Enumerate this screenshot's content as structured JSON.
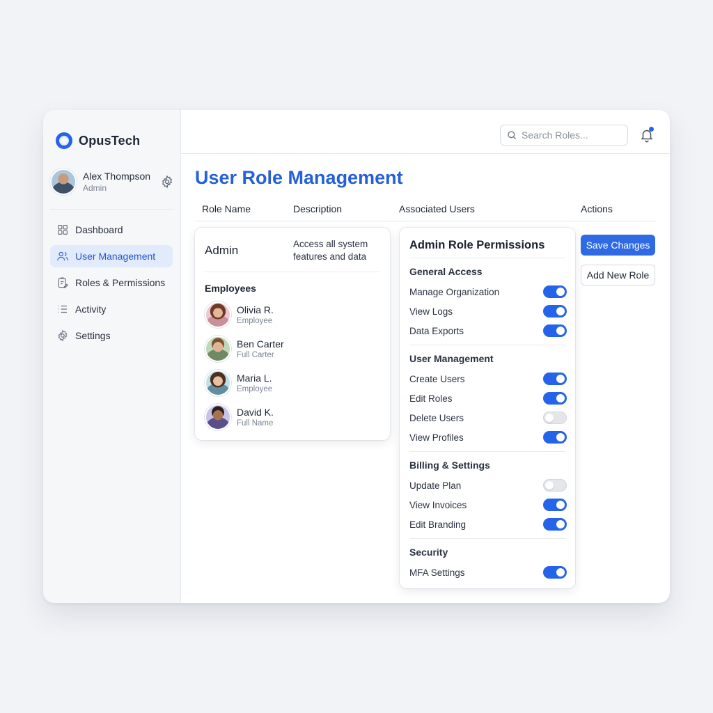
{
  "brand": {
    "name": "OpusTech",
    "accent": "#2563eb"
  },
  "user": {
    "name": "Alex Thompson",
    "role": "Admin"
  },
  "sidebar": {
    "items": [
      {
        "label": "Dashboard",
        "icon": "grid-icon"
      },
      {
        "label": "User Management",
        "icon": "users-icon",
        "active": true
      },
      {
        "label": "Roles & Permissions",
        "icon": "clipboard-icon"
      },
      {
        "label": "Activity",
        "icon": "list-icon"
      },
      {
        "label": "Settings",
        "icon": "gear-icon"
      }
    ]
  },
  "topbar": {
    "search_placeholder": "Search Roles..."
  },
  "page": {
    "title": "User Role Management"
  },
  "table": {
    "columns": [
      "Role Name",
      "Description",
      "Associated Users",
      "Actions"
    ]
  },
  "role": {
    "name": "Admin",
    "description": "Access all system features and data",
    "employees_title": "Employees",
    "employees": [
      {
        "name": "Olivia R.",
        "subtitle": "Employee"
      },
      {
        "name": "Ben Carter",
        "subtitle": "Full Carter"
      },
      {
        "name": "Maria L.",
        "subtitle": "Employee"
      },
      {
        "name": "David K.",
        "subtitle": "Full Name"
      }
    ]
  },
  "permissions": {
    "title": "Admin Role Permissions",
    "groups": [
      {
        "title": "General Access",
        "items": [
          {
            "label": "Manage Organization",
            "enabled": true
          },
          {
            "label": "View Logs",
            "enabled": true
          },
          {
            "label": "Data Exports",
            "enabled": true
          }
        ]
      },
      {
        "title": "User Management",
        "items": [
          {
            "label": "Create Users",
            "enabled": true
          },
          {
            "label": "Edit Roles",
            "enabled": true
          },
          {
            "label": "Delete Users",
            "enabled": false
          },
          {
            "label": "View Profiles",
            "enabled": true
          }
        ]
      },
      {
        "title": "Billing & Settings",
        "items": [
          {
            "label": "Update Plan",
            "enabled": false
          },
          {
            "label": "View Invoices",
            "enabled": true
          },
          {
            "label": "Edit Branding",
            "enabled": true
          }
        ]
      },
      {
        "title": "Security",
        "items": [
          {
            "label": "MFA Settings",
            "enabled": true
          }
        ]
      }
    ]
  },
  "actions": {
    "save_label": "Save Changes",
    "add_label": "Add New Role"
  }
}
